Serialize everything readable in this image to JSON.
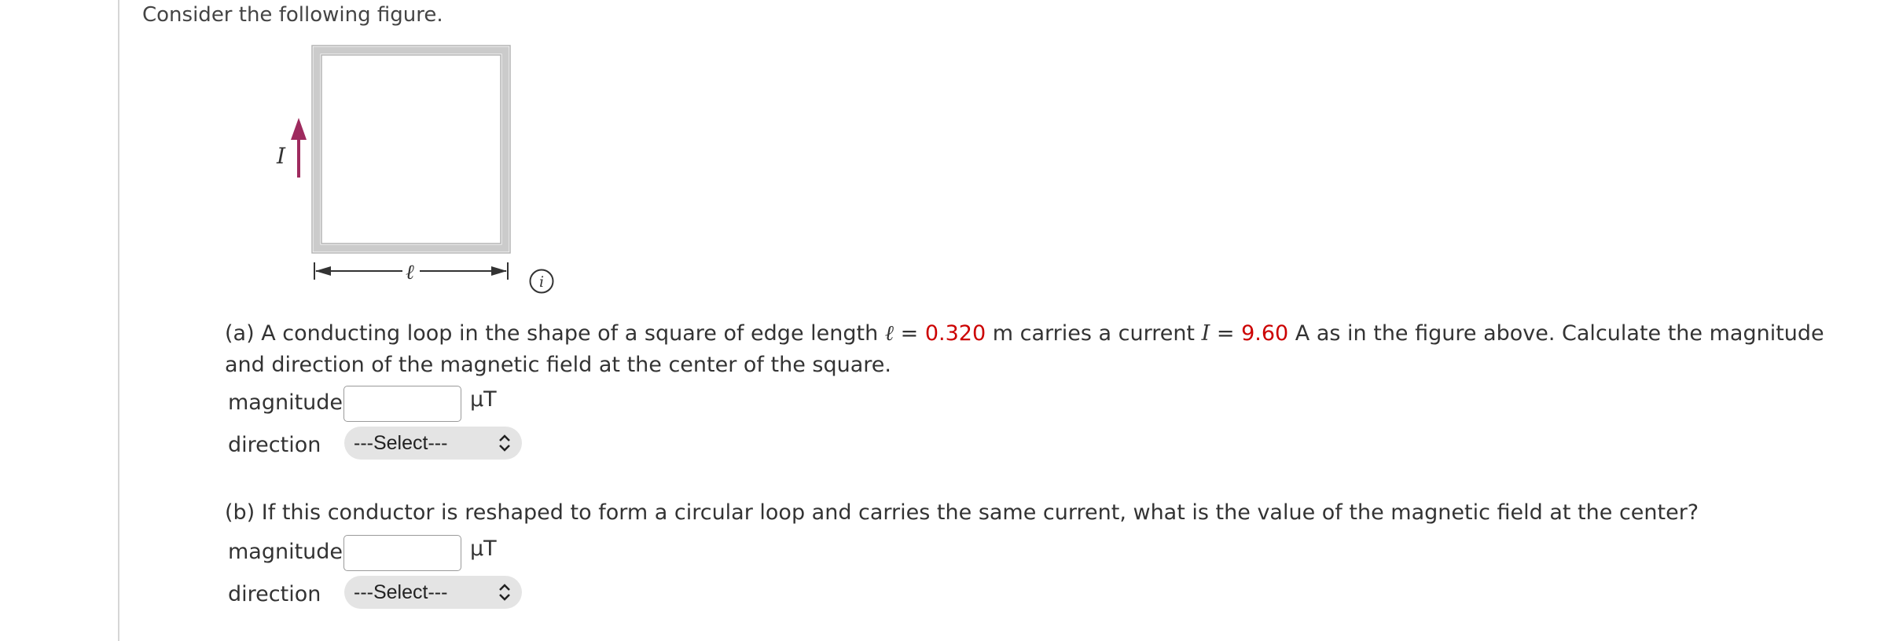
{
  "intro": "Consider the following figure.",
  "figure": {
    "current_label": "I",
    "edge_label": "ℓ"
  },
  "info_icon": "info-icon",
  "part_a": {
    "prefix": "(a) A conducting loop in the shape of a square of edge length ",
    "ell_symbol": "ℓ",
    "eq1": " = ",
    "length_value": "0.320",
    "after_length": " m carries a current ",
    "current_symbol": "I",
    "eq2": " = ",
    "current_value": "9.60",
    "after_current": " A as in the figure above. Calculate the magnitude and direction of the magnetic field at the center of the square.",
    "magnitude_label": "magnitude",
    "magnitude_value": "",
    "unit": "μT",
    "direction_label": "direction",
    "direction_selected": "---Select---"
  },
  "part_b": {
    "text": "(b) If this conductor is reshaped to form a circular loop and carries the same current, what is the value of the magnetic field at the center?",
    "magnitude_label": "magnitude",
    "magnitude_value": "",
    "unit": "μT",
    "direction_label": "direction",
    "direction_selected": "---Select---"
  },
  "colors": {
    "given_value": "#cc0000",
    "arrow": "#9e2a5e",
    "loop": "#c8c8c8"
  }
}
